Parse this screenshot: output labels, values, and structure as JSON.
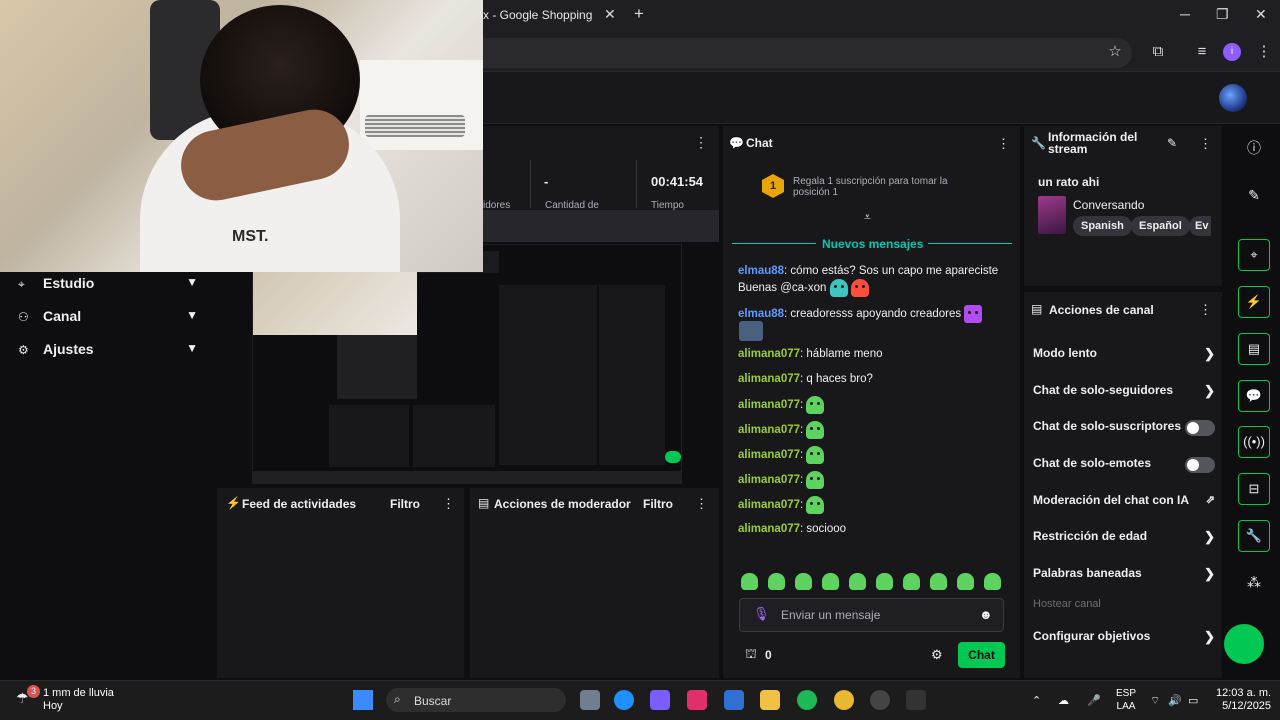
{
  "browser": {
    "tab_title": "x - Google Shopping",
    "tab_close": "✕",
    "new_tab": "+",
    "min": "─",
    "max": "❐",
    "close": "✕",
    "profile_letter": "i"
  },
  "webcam": {
    "shirt_text": "MST."
  },
  "nav": {
    "items": [
      {
        "label": "Estudio",
        "icon": "studio-icon"
      },
      {
        "label": "Canal",
        "icon": "channel-icon"
      },
      {
        "label": "Ajustes",
        "icon": "settings-icon"
      }
    ]
  },
  "stats": {
    "value_2": "-",
    "value_3": "00:41:54",
    "label_1": "idores",
    "label_2": "Cantidad de",
    "label_3": "Tiempo"
  },
  "feed": {
    "title": "Feed de actividades",
    "filter": "Filtro"
  },
  "mod": {
    "title": "Acciones de moderador",
    "filter": "Filtro"
  },
  "chat": {
    "title": "Chat",
    "pinned_rank": "1",
    "pinned_text": "Regala 1 suscripción para tomar la posición 1",
    "new_messages": "Nuevos mensajes",
    "messages": [
      {
        "user": "elmau88",
        "text": ": cómo estás? Sos un capo me apareciste Buenas @ca-xon"
      },
      {
        "user": "elmau88",
        "text": ": creadoresss apoyando creadores"
      },
      {
        "user": "alimana077",
        "text": ": háblame meno"
      },
      {
        "user": "alimana077",
        "text": ": q haces bro?"
      },
      {
        "user": "alimana077",
        "text": ":"
      },
      {
        "user": "alimana077",
        "text": ":"
      },
      {
        "user": "alimana077",
        "text": ":"
      },
      {
        "user": "alimana077",
        "text": ":"
      },
      {
        "user": "alimana077",
        "text": ":"
      },
      {
        "user": "alimana077",
        "text": ": sociooo"
      }
    ],
    "input_placeholder": "Enviar un mensaje",
    "points": "0",
    "send_label": "Chat"
  },
  "info": {
    "title": "Información del stream",
    "stream_title": "un rato ahi",
    "category": "Conversando",
    "tags": [
      "Spanish",
      "Español",
      "Ev"
    ]
  },
  "actions": {
    "title": "Acciones de canal",
    "rows": [
      {
        "label": "Modo lento",
        "control": "chevron"
      },
      {
        "label": "Chat de solo-seguidores",
        "control": "chevron"
      },
      {
        "label": "Chat de solo-suscriptores",
        "control": "toggle"
      },
      {
        "label": "Chat de solo-emotes",
        "control": "toggle"
      },
      {
        "label": "Moderación del chat con IA",
        "control": "external"
      },
      {
        "label": "Restricción de edad",
        "control": "chevron"
      },
      {
        "label": "Palabras baneadas",
        "control": "chevron"
      },
      {
        "label": "Configurar objetivos",
        "control": "chevron"
      }
    ],
    "host_label": "Hostear canal"
  },
  "taskbar": {
    "weather_line1": "1 mm de lluvia",
    "weather_line2": "Hoy",
    "weather_badge": "3",
    "search_placeholder": "Buscar",
    "lang_line1": "ESP",
    "lang_line2": "LAA",
    "time": "12:03 a. m.",
    "date": "5/12/2025"
  },
  "colors": {
    "accent_green": "#00c853",
    "accent_teal": "#00c8af",
    "user_blue": "#5b9bff",
    "user_green": "#9acd32",
    "bg": "#0e0e10",
    "panel": "#18181b"
  }
}
